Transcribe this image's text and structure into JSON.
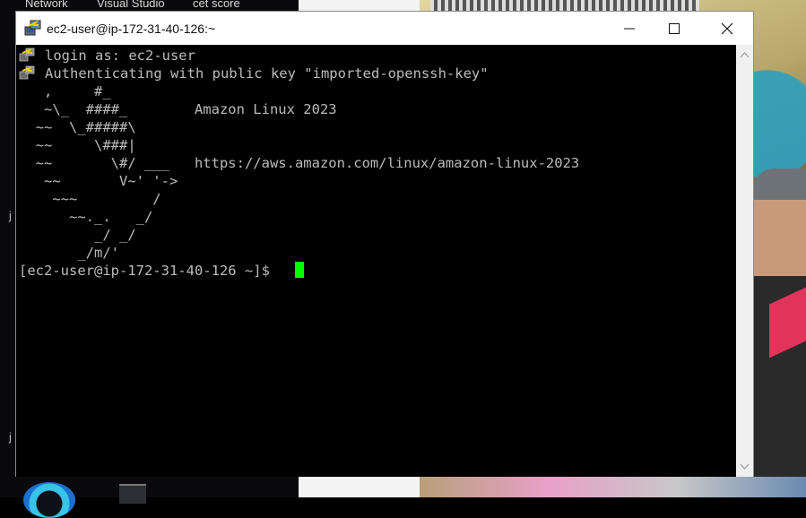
{
  "desktop": {
    "top_labels": [
      "Network",
      "Visual Studio",
      "cet score"
    ],
    "side_labels": [
      "j",
      "j"
    ]
  },
  "window": {
    "title": "ec2-user@ip-172-31-40-126:~",
    "icon": "putty-icon",
    "controls": {
      "minimize": "minimize-icon",
      "maximize": "maximize-icon",
      "close": "close-icon"
    }
  },
  "terminal": {
    "lines": [
      "login as: ec2-user",
      "Authenticating with public key \"imported-openssh-key\"",
      "   ,     #_",
      "   ~\\_  ####_        Amazon Linux 2023",
      "  ~~  \\_#####\\",
      "  ~~     \\###|",
      "  ~~       \\#/ ___   https://aws.amazon.com/linux/amazon-linux-2023",
      "   ~~       V~' '->",
      "    ~~~         /",
      "      ~~._.   _/",
      "         _/ _/",
      "       _/m/'",
      "[ec2-user@ip-172-31-40-126 ~]$ "
    ],
    "cursor_color": "#00ff00",
    "text_color": "#bbbbbb",
    "background": "#000000"
  }
}
